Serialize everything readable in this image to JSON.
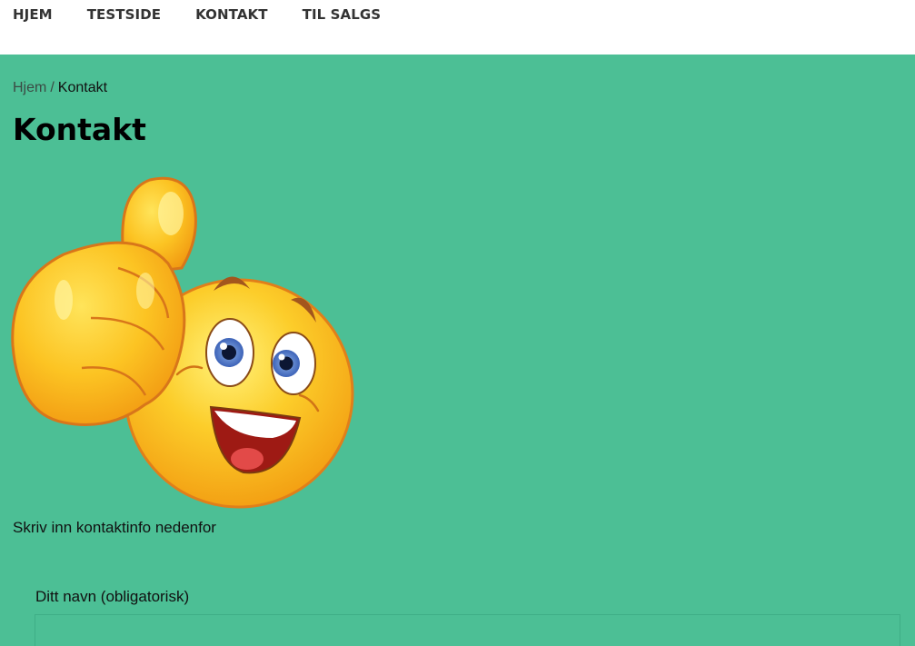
{
  "nav": {
    "items": [
      {
        "label": "HJEM"
      },
      {
        "label": "TESTSIDE"
      },
      {
        "label": "KONTAKT"
      },
      {
        "label": "TIL SALGS"
      }
    ]
  },
  "breadcrumb": {
    "home": "Hjem",
    "separator": "/",
    "current": "Kontakt"
  },
  "page": {
    "title": "Kontakt",
    "intro": "Skriv inn kontaktinfo nedenfor"
  },
  "form": {
    "name_label": "Ditt navn (obligatorisk)",
    "name_value": ""
  },
  "colors": {
    "background": "#4cbf95",
    "header": "#ffffff",
    "emoji_yellow": "#fbbf1c"
  }
}
